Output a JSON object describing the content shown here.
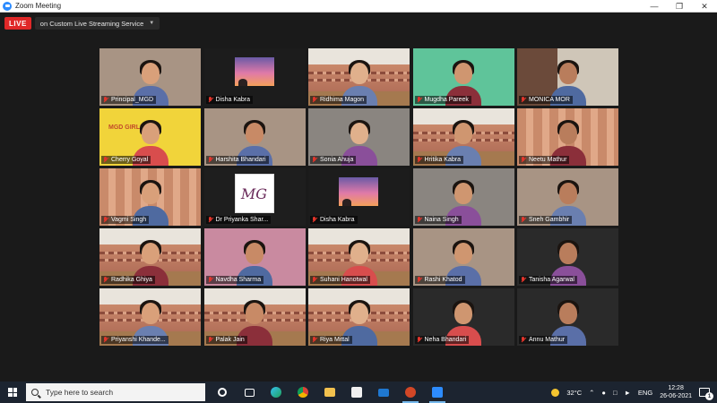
{
  "window": {
    "title": "Zoom Meeting"
  },
  "live": {
    "badge": "LIVE",
    "service": "on Custom Live Streaming Service"
  },
  "participants": [
    {
      "name": "Principal_MGD",
      "bg": "room"
    },
    {
      "name": "Disha Kabra",
      "bg": "sunset"
    },
    {
      "name": "Ridhima Magon",
      "bg": "building"
    },
    {
      "name": "Mugdha Pareek",
      "bg": "green"
    },
    {
      "name": "MONICA MOR",
      "bg": "shelf"
    },
    {
      "name": "Cherry Goyal",
      "bg": "banner"
    },
    {
      "name": "Harshita Bhandari",
      "bg": "room"
    },
    {
      "name": "Sonia Ahuja",
      "bg": "grey"
    },
    {
      "name": "Hritika Kabra",
      "bg": "building"
    },
    {
      "name": "Neetu Mathur",
      "bg": "curtain"
    },
    {
      "name": "Vagmi Singh",
      "bg": "curtain",
      "active": true
    },
    {
      "name": "Dr Priyanka Shar...",
      "bg": "logo"
    },
    {
      "name": "Disha Kabra",
      "bg": "sunset"
    },
    {
      "name": "Naina Singh",
      "bg": "grey"
    },
    {
      "name": "Sneh Gambhir",
      "bg": "room"
    },
    {
      "name": "Radhika Ghiya",
      "bg": "building"
    },
    {
      "name": "Navdha Sharma",
      "bg": "pink"
    },
    {
      "name": "Suhani Hanotwal",
      "bg": "building"
    },
    {
      "name": "Rashi Khatod",
      "bg": "room"
    },
    {
      "name": "Tanisha Agarwal",
      "bg": "dark"
    },
    {
      "name": "Priyanshi Khande...",
      "bg": "building"
    },
    {
      "name": "Palak Jain",
      "bg": "building"
    },
    {
      "name": "Riya Mittal",
      "bg": "building"
    },
    {
      "name": "Neha Bhandari",
      "bg": "dark"
    },
    {
      "name": "Annu Mathur",
      "bg": "dark"
    }
  ],
  "taskbar": {
    "search_placeholder": "Type here to search",
    "weather": "32°C",
    "language": "ENG",
    "time": "12:28",
    "date": "26-06-2021",
    "notifications": "1"
  }
}
